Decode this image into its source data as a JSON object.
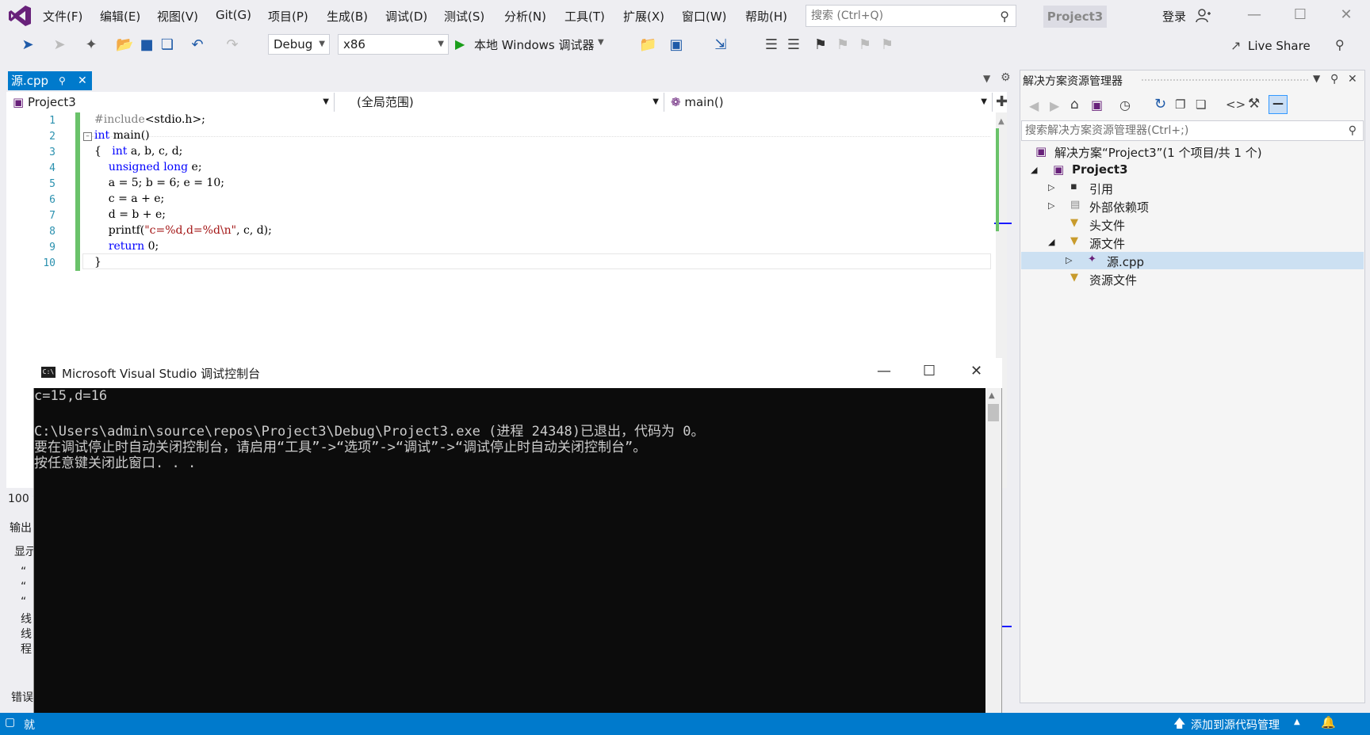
{
  "menu": [
    "文件(F)",
    "编辑(E)",
    "视图(V)",
    "Git(G)",
    "项目(P)",
    "生成(B)",
    "调试(D)",
    "测试(S)",
    "分析(N)",
    "工具(T)",
    "扩展(X)",
    "窗口(W)",
    "帮助(H)"
  ],
  "search": {
    "placeholder": "搜索 (Ctrl+Q)"
  },
  "project_badge": "Project3",
  "login": "登录",
  "toolbar": {
    "config": "Debug",
    "platform": "x86",
    "run_label": "本地 Windows 调试器",
    "live_share": "Live Share"
  },
  "editor": {
    "tab": "源.cpp",
    "nav_project": "Project3",
    "nav_scope": "(全局范围)",
    "nav_member": "main()",
    "zoom": "100 %",
    "line_numbers": [
      "1",
      "2",
      "3",
      "4",
      "5",
      "6",
      "7",
      "8",
      "9",
      "10"
    ],
    "lines": [
      "#include<stdio.h>;",
      "int main()",
      "{   int a, b, c, d;",
      "    unsigned long e;",
      "    a = 5; b = 6; e = 10;",
      "    c = a + e;",
      "    d = b + e;",
      "    printf(\"c=%d,d=%d\\n\", c, d);",
      "    return 0;",
      "}"
    ]
  },
  "output_panel": {
    "title": "输出",
    "show_label": "显示",
    "lines": [
      "“",
      "“",
      "“",
      "线",
      "线",
      "程"
    ],
    "error_tab": "错误"
  },
  "solution_explorer": {
    "title": "解决方案资源管理器",
    "search_placeholder": "搜索解决方案资源管理器(Ctrl+;)",
    "solution": "解决方案“Project3”(1 个项目/共 1 个)",
    "project": "Project3",
    "items": [
      "引用",
      "外部依赖项",
      "头文件",
      "源文件",
      "源.cpp",
      "资源文件"
    ]
  },
  "console": {
    "title": "Microsoft Visual Studio 调试控制台",
    "icon_text": "C:\\",
    "lines": [
      "c=15,d=16",
      "",
      "C:\\Users\\admin\\source\\repos\\Project3\\Debug\\Project3.exe (进程 24348)已退出，代码为 0。",
      "要在调试停止时自动关闭控制台，请启用“工具”->“选项”->“调试”->“调试停止时自动关闭控制台”。",
      "按任意键关闭此窗口. . ."
    ]
  },
  "status": {
    "left": "就",
    "source_control": "添加到源代码管理"
  },
  "colors": {
    "accent": "#007acc",
    "console_bg": "#0c0c0c"
  }
}
